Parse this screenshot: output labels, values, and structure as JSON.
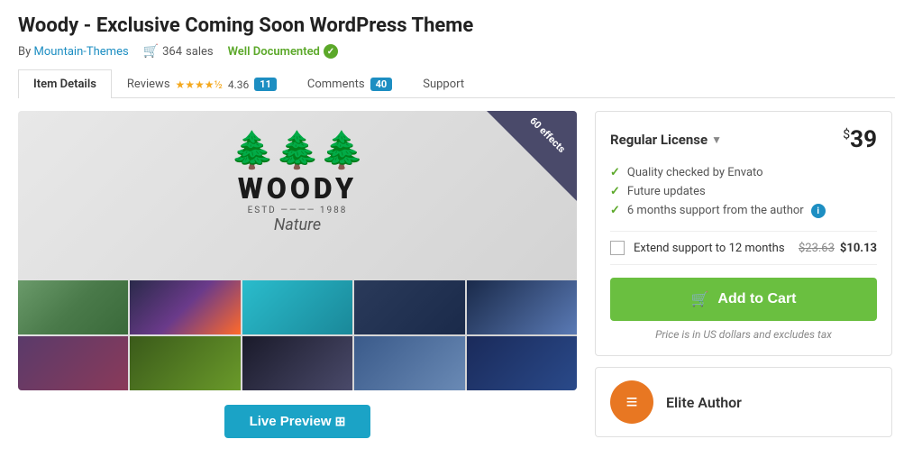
{
  "page": {
    "title": "Woody - Exclusive Coming Soon WordPress Theme",
    "author": {
      "label": "By",
      "name": "Mountain-Themes"
    },
    "sales": {
      "count": "364",
      "label": "sales"
    },
    "well_documented": "Well Documented"
  },
  "tabs": [
    {
      "id": "item-details",
      "label": "Item Details",
      "active": true
    },
    {
      "id": "reviews",
      "label": "Reviews"
    },
    {
      "id": "comments",
      "label": "Comments"
    },
    {
      "id": "support",
      "label": "Support"
    }
  ],
  "reviews": {
    "rating": "4.36",
    "count": "11"
  },
  "comments": {
    "count": "40"
  },
  "preview": {
    "badge_line1": "60 effects",
    "woody_brand": "WOODY",
    "estd": "ESTD",
    "year": "1988",
    "nature": "Nature"
  },
  "live_preview_button": "Live Preview",
  "sidebar": {
    "license": {
      "name": "Regular License",
      "price_superscript": "$",
      "price": "39",
      "features": [
        {
          "text": "Quality checked by Envato"
        },
        {
          "text": "Future updates"
        },
        {
          "text": "6 months support from the author",
          "has_info": true
        }
      ],
      "extend_support": {
        "label": "Extend support to 12 months",
        "old_price": "$23.63",
        "new_price": "$10.13"
      },
      "add_to_cart": "Add to Cart",
      "tax_note": "Price is in US dollars and excludes tax"
    },
    "author": {
      "badge": "Elite Author",
      "avatar_icon": "≡"
    }
  }
}
